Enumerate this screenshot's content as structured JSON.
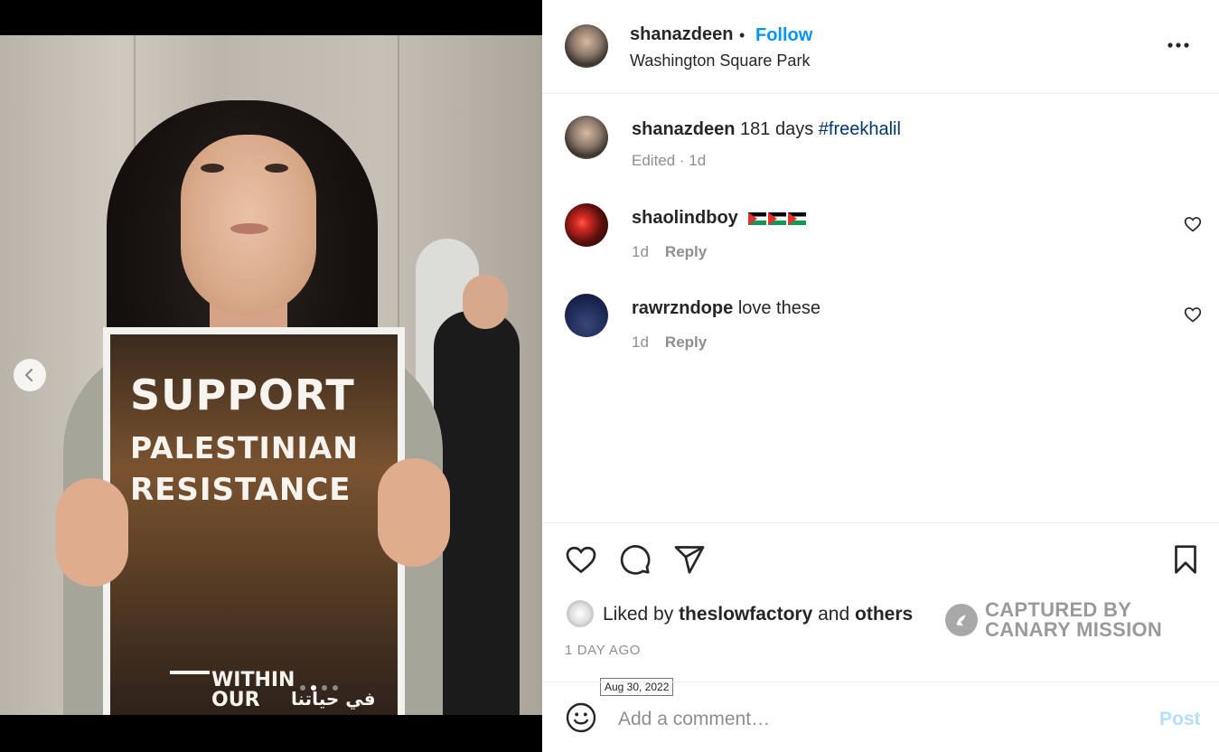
{
  "post": {
    "username": "shanazdeen",
    "follow_label": "Follow",
    "separator": "•",
    "location": "Washington Square Park",
    "more_label": "•••"
  },
  "media": {
    "poster_line1": "SUPPORT",
    "poster_line2": "PALESTINIAN",
    "poster_line3": "RESISTANCE",
    "poster_small1": "WITHIN",
    "poster_small2": "OUR",
    "poster_arabic": "في حياتنا",
    "carousel_prev": "‹",
    "slide_count": 4,
    "active_slide": 1
  },
  "caption": {
    "username": "shanazdeen",
    "text": "181 days",
    "hashtag": "#freekhalil",
    "meta": "Edited · 1d"
  },
  "comments": [
    {
      "username": "shaolindboy",
      "text": "",
      "emoji": "🇵🇸🇵🇸🇵🇸",
      "time": "1d",
      "reply": "Reply"
    },
    {
      "username": "rawrzndope",
      "text": "love these",
      "time": "1d",
      "reply": "Reply"
    }
  ],
  "likes": {
    "prefix": "Liked by",
    "user": "theslowfactory",
    "conj": "and",
    "others": "others"
  },
  "time_ago": "1 DAY AGO",
  "tooltip": "Aug 30, 2022",
  "watermark": {
    "line1": "CAPTURED BY",
    "line2": "CANARY MISSION"
  },
  "comment_box": {
    "placeholder": "Add a comment…",
    "value": "",
    "post_label": "Post"
  },
  "colors": {
    "accent": "#0095f6",
    "hashtag": "#00376b",
    "muted": "#8e8e8e",
    "post_disabled": "#b2dffc"
  },
  "icons": [
    "heart-icon",
    "comment-icon",
    "share-icon",
    "bookmark-icon",
    "emoji-icon",
    "more-icon",
    "chevron-left-icon"
  ]
}
